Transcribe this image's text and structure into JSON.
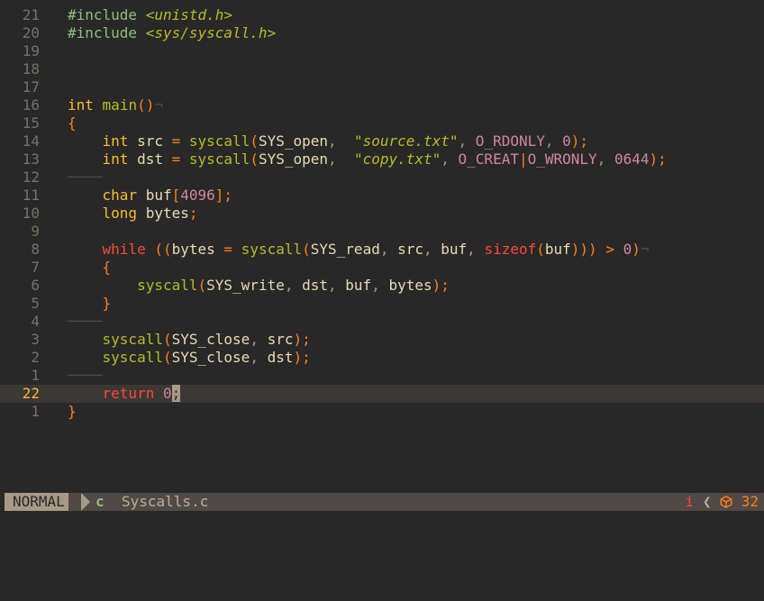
{
  "editor": {
    "lines": [
      {
        "nr": "21",
        "indent": "",
        "tokens": [
          [
            "pre",
            "#include "
          ],
          [
            "inc",
            "<unistd.h>"
          ]
        ]
      },
      {
        "nr": "20",
        "indent": "",
        "tokens": [
          [
            "pre",
            "#include "
          ],
          [
            "inc",
            "<sys/syscall.h>"
          ]
        ]
      },
      {
        "nr": "19",
        "indent": "",
        "tokens": []
      },
      {
        "nr": "18",
        "indent": "",
        "tokens": []
      },
      {
        "nr": "17",
        "indent": "",
        "tokens": []
      },
      {
        "nr": "16",
        "indent": "",
        "tokens": [
          [
            "type",
            "int"
          ],
          [
            "plain",
            " "
          ],
          [
            "fn",
            "main"
          ],
          [
            "paren",
            "()"
          ],
          [
            "eol",
            "¬"
          ]
        ]
      },
      {
        "nr": "15",
        "indent": "",
        "tokens": [
          [
            "paren",
            "{"
          ]
        ]
      },
      {
        "nr": "14",
        "indent": "    ",
        "tokens": [
          [
            "type",
            "int"
          ],
          [
            "plain",
            " src "
          ],
          [
            "op",
            "="
          ],
          [
            "plain",
            " "
          ],
          [
            "fn",
            "syscall"
          ],
          [
            "paren",
            "("
          ],
          [
            "plain",
            "SYS_open"
          ],
          [
            "punc",
            ",  "
          ],
          [
            "str",
            "\"source.txt\""
          ],
          [
            "punc",
            ", "
          ],
          [
            "const",
            "O_RDONLY"
          ],
          [
            "punc",
            ", "
          ],
          [
            "num",
            "0"
          ],
          [
            "paren",
            ")"
          ],
          [
            "op",
            ";"
          ]
        ]
      },
      {
        "nr": "13",
        "indent": "    ",
        "tokens": [
          [
            "type",
            "int"
          ],
          [
            "plain",
            " dst "
          ],
          [
            "op",
            "="
          ],
          [
            "plain",
            " "
          ],
          [
            "fn",
            "syscall"
          ],
          [
            "paren",
            "("
          ],
          [
            "plain",
            "SYS_open"
          ],
          [
            "punc",
            ",  "
          ],
          [
            "str",
            "\"copy.txt\""
          ],
          [
            "punc",
            ", "
          ],
          [
            "const",
            "O_CREAT"
          ],
          [
            "op",
            "|"
          ],
          [
            "const",
            "O_WRONLY"
          ],
          [
            "punc",
            ", "
          ],
          [
            "num",
            "0644"
          ],
          [
            "paren",
            ")"
          ],
          [
            "op",
            ";"
          ]
        ]
      },
      {
        "nr": "12",
        "indent": "",
        "tokens": [
          [
            "guide",
            "────"
          ]
        ]
      },
      {
        "nr": "11",
        "indent": "    ",
        "tokens": [
          [
            "type",
            "char"
          ],
          [
            "plain",
            " buf"
          ],
          [
            "paren",
            "["
          ],
          [
            "num",
            "4096"
          ],
          [
            "paren",
            "]"
          ],
          [
            "op",
            ";"
          ]
        ]
      },
      {
        "nr": "10",
        "indent": "    ",
        "tokens": [
          [
            "type",
            "long"
          ],
          [
            "plain",
            " bytes"
          ],
          [
            "op",
            ";"
          ]
        ]
      },
      {
        "nr": "9",
        "indent": "",
        "tokens": []
      },
      {
        "nr": "8",
        "indent": "    ",
        "tokens": [
          [
            "kw",
            "while"
          ],
          [
            "plain",
            " "
          ],
          [
            "paren",
            "(("
          ],
          [
            "plain",
            "bytes "
          ],
          [
            "op",
            "="
          ],
          [
            "plain",
            " "
          ],
          [
            "fn",
            "syscall"
          ],
          [
            "paren",
            "("
          ],
          [
            "plain",
            "SYS_read"
          ],
          [
            "punc",
            ", "
          ],
          [
            "plain",
            "src"
          ],
          [
            "punc",
            ", "
          ],
          [
            "plain",
            "buf"
          ],
          [
            "punc",
            ", "
          ],
          [
            "kw",
            "sizeof"
          ],
          [
            "paren",
            "("
          ],
          [
            "plain",
            "buf"
          ],
          [
            "paren",
            ")))"
          ],
          [
            "plain",
            " "
          ],
          [
            "op",
            ">"
          ],
          [
            "plain",
            " "
          ],
          [
            "num",
            "0"
          ],
          [
            "paren",
            ")"
          ],
          [
            "eol",
            "¬"
          ]
        ]
      },
      {
        "nr": "7",
        "indent": "    ",
        "tokens": [
          [
            "paren",
            "{"
          ]
        ]
      },
      {
        "nr": "6",
        "indent": "        ",
        "tokens": [
          [
            "fn",
            "syscall"
          ],
          [
            "paren",
            "("
          ],
          [
            "plain",
            "SYS_write"
          ],
          [
            "punc",
            ", "
          ],
          [
            "plain",
            "dst"
          ],
          [
            "punc",
            ", "
          ],
          [
            "plain",
            "buf"
          ],
          [
            "punc",
            ", "
          ],
          [
            "plain",
            "bytes"
          ],
          [
            "paren",
            ")"
          ],
          [
            "op",
            ";"
          ]
        ]
      },
      {
        "nr": "5",
        "indent": "    ",
        "tokens": [
          [
            "paren",
            "}"
          ]
        ]
      },
      {
        "nr": "4",
        "indent": "",
        "tokens": [
          [
            "guide",
            "────"
          ]
        ]
      },
      {
        "nr": "3",
        "indent": "    ",
        "tokens": [
          [
            "fn",
            "syscall"
          ],
          [
            "paren",
            "("
          ],
          [
            "plain",
            "SYS_close"
          ],
          [
            "punc",
            ", "
          ],
          [
            "plain",
            "src"
          ],
          [
            "paren",
            ")"
          ],
          [
            "op",
            ";"
          ]
        ]
      },
      {
        "nr": "2",
        "indent": "    ",
        "tokens": [
          [
            "fn",
            "syscall"
          ],
          [
            "paren",
            "("
          ],
          [
            "plain",
            "SYS_close"
          ],
          [
            "punc",
            ", "
          ],
          [
            "plain",
            "dst"
          ],
          [
            "paren",
            ")"
          ],
          [
            "op",
            ";"
          ]
        ]
      },
      {
        "nr": "1",
        "indent": "",
        "tokens": [
          [
            "guide",
            "────"
          ]
        ]
      },
      {
        "nr": "22",
        "indent": "    ",
        "current": true,
        "tokens": [
          [
            "kw",
            "return"
          ],
          [
            "plain",
            " "
          ],
          [
            "num",
            "0"
          ],
          [
            "cursor",
            ";"
          ]
        ]
      },
      {
        "nr": "1",
        "indent": "",
        "tokens": [
          [
            "paren",
            "}"
          ]
        ]
      }
    ]
  },
  "statusline": {
    "mode": "NORMAL",
    "filetype_icon": "c",
    "filename": "Syscalls.c",
    "diagnostic_label": "i",
    "separator": "❮",
    "package_icon": "package-icon",
    "column": "32"
  },
  "colors": {
    "background": "#282828",
    "cursorline": "#3c3836",
    "statusline": "#504945",
    "mode_bg": "#a89984"
  }
}
